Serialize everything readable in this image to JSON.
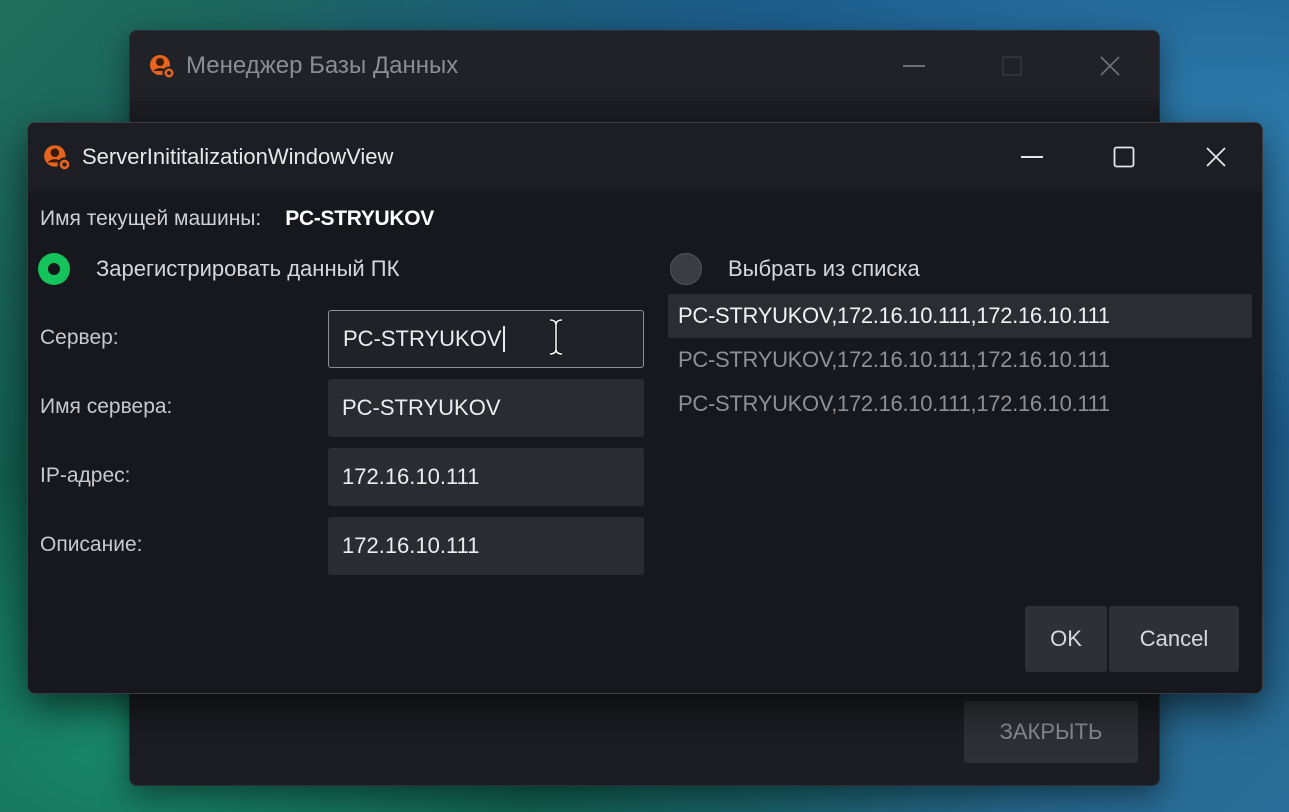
{
  "background_window": {
    "title": "Менеджер Базы Данных",
    "close_label": "ЗАКРЫТЬ"
  },
  "dialog": {
    "title": "ServerInititalizationWindowView",
    "machine_label": "Имя текущей машины:",
    "machine_name": "PC-STRYUKOV",
    "radio_register": {
      "label": "Зарегистрировать данный ПК",
      "selected": true
    },
    "radio_list": {
      "label": "Выбрать из списка",
      "selected": false
    },
    "fields": {
      "server": {
        "label": "Сервер:",
        "value": "PC-STRYUKOV"
      },
      "server_name": {
        "label": "Имя сервера:",
        "value": "PC-STRYUKOV"
      },
      "ip": {
        "label": "IP-адрес:",
        "value": "172.16.10.111"
      },
      "description": {
        "label": "Описание:",
        "value": "172.16.10.111"
      }
    },
    "server_list": [
      "PC-STRYUKOV,172.16.10.111,172.16.10.111",
      "PC-STRYUKOV,172.16.10.111,172.16.10.111",
      "PC-STRYUKOV,172.16.10.111,172.16.10.111"
    ],
    "ok_label": "OK",
    "cancel_label": "Cancel"
  },
  "colors": {
    "accent_green": "#14c45a",
    "app_icon_orange": "#e8641e",
    "window_bg": "#16181d"
  },
  "icons": [
    "app-logo-icon",
    "minimize-icon",
    "maximize-icon",
    "close-icon",
    "text-cursor-icon"
  ]
}
